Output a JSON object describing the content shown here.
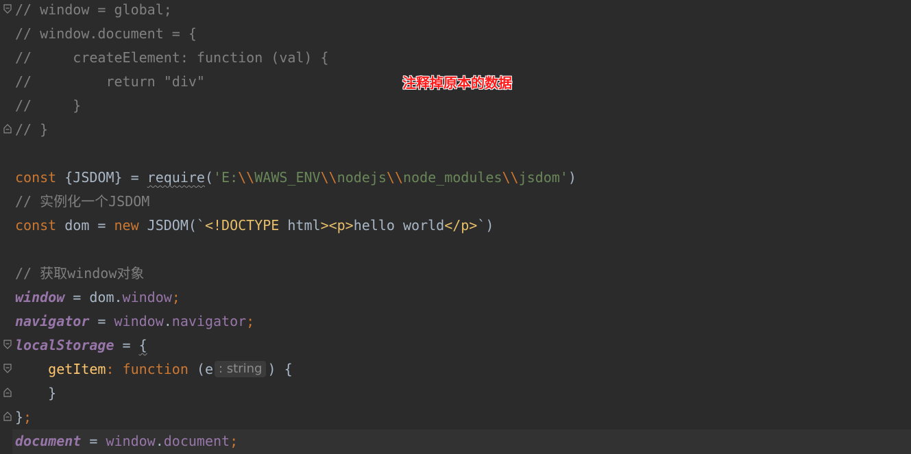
{
  "annotation": {
    "text": "注释掉原本的数据",
    "color": "#ff1a1a"
  },
  "colors": {
    "background": "#2b2b2b",
    "comment": "#808080",
    "keyword": "#cc7832",
    "string": "#6a8759",
    "global_var": "#9876aa",
    "function_name": "#ffc66d",
    "plain": "#a9b7c6"
  },
  "code": {
    "l1": "// window = global;",
    "l2": "// window.document = {",
    "l3": "//     createElement: function (val) {",
    "l4": "//         return \"div\"",
    "l5": "//     }",
    "l6": "// }",
    "l8": {
      "kw": "const",
      "destructure": " {JSDOM} = ",
      "fn": "require",
      "open": "(",
      "str_a": "'E:",
      "esc1": "\\\\",
      "str_b": "WAWS_ENV",
      "esc2": "\\\\",
      "str_c": "nodejs",
      "esc3": "\\\\",
      "str_d": "node_modules",
      "esc4": "\\\\",
      "str_e": "jsdom'",
      "close": ")"
    },
    "l9": "// 实例化一个JSDOM",
    "l10": {
      "kw": "const",
      "mid": " dom = ",
      "kw2": "new",
      "call": " JSDOM(`",
      "doctype": "<!DOCTYPE",
      "html": " html",
      "t1": "><p>",
      "text": "hello world",
      "t2": "</p>",
      "end": "`)"
    },
    "l12": "// 获取window对象",
    "l13": {
      "var": "window",
      "eq": " = dom.",
      "prop": "window",
      "semi": ";"
    },
    "l14": {
      "var": "navigator",
      "eq": " = ",
      "obj": "window",
      "dot": ".",
      "prop": "navigator",
      "semi": ";"
    },
    "l15": {
      "var": "localStorage",
      "eq": " = ",
      "brace": "{"
    },
    "l16": {
      "indent": "    ",
      "fn": "getItem",
      "colon": ": ",
      "kw": "function",
      "open": " (e",
      "hint": ": string",
      "close": ") {"
    },
    "l17": "    }",
    "l18": {
      "brace": "}",
      "semi": ";"
    },
    "l19": {
      "var": "document",
      "eq": " = ",
      "obj": "window",
      "dot": ".",
      "prop": "document",
      "semi": ";"
    }
  }
}
